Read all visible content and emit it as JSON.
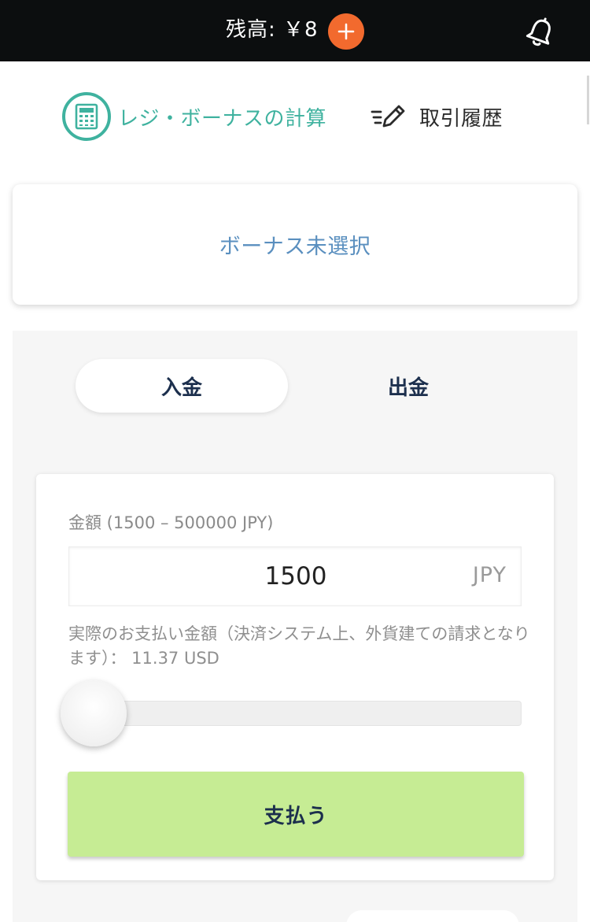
{
  "header": {
    "balance_label": "残高: ￥8",
    "add_icon": "plus-icon",
    "bell_icon": "bell-icon",
    "accent_color": "#f26a2e"
  },
  "quick_nav": {
    "calculator_label": "レジ・ボーナスの計算",
    "calculator_icon": "calculator-icon",
    "history_label": "取引履歴",
    "history_icon": "pencil-edit-icon",
    "accent_color": "#3fb29f"
  },
  "bonus": {
    "label": "ボーナス未選択"
  },
  "wallet": {
    "tabs": [
      {
        "label": "入金",
        "active": true
      },
      {
        "label": "出金",
        "active": false
      }
    ],
    "amount_label": "金額 (1500 – 500000 JPY)",
    "amount_value": "1500",
    "currency": "JPY",
    "payment_note": "実際のお支払い金額（決済システム上、外貨建ての請求となります）： 11.37 USD",
    "slider": {
      "min": 1500,
      "max": 500000,
      "value": 1500
    },
    "pay_button_label": "支払う",
    "pay_button_color": "#c6ec94"
  }
}
